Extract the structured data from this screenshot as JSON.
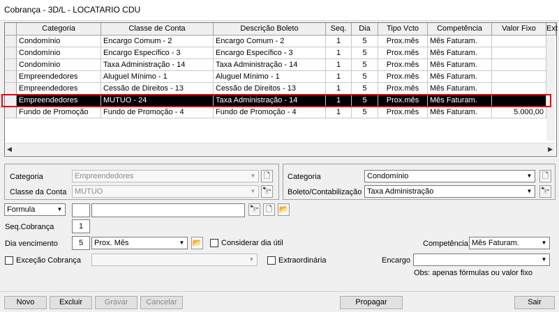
{
  "window": {
    "title": "Cobrança - 3D/L - LOCATARIO CDU"
  },
  "grid": {
    "columns": [
      "Categoria",
      "Classe de Conta",
      "Descrição Boleto",
      "Seq.",
      "Dia",
      "Tipo Vcto",
      "Competência",
      "Valor Fixo",
      "Ext"
    ],
    "rows": [
      [
        "Condomínio",
        "Encargo Comum - 2",
        "Encargo Comum - 2",
        "1",
        "5",
        "Prox.mês",
        "Mês Faturam.",
        ""
      ],
      [
        "Condomínio",
        "Encargo Específico - 3",
        "Encargo Específico - 3",
        "1",
        "5",
        "Prox.mês",
        "Mês Faturam.",
        ""
      ],
      [
        "Condomínio",
        "Taxa Administração - 14",
        "Taxa Administração - 14",
        "1",
        "5",
        "Prox.mês",
        "Mês Faturam.",
        ""
      ],
      [
        "Empreendedores",
        "Aluguel Mínimo - 1",
        "Aluguel Mínimo - 1",
        "1",
        "5",
        "Prox.mês",
        "Mês Faturam.",
        ""
      ],
      [
        "Empreendedores",
        "Cessão de Direitos - 13",
        "Cessão de Direitos - 13",
        "1",
        "5",
        "Prox.mês",
        "Mês Faturam.",
        ""
      ],
      [
        "Empreendedores",
        "MUTUO - 24",
        "Taxa Administração - 14",
        "1",
        "5",
        "Prox.mês",
        "Mês Faturam.",
        ""
      ],
      [
        "Fundo de Promoção",
        "Fundo de Promoção - 4",
        "Fundo de Promoção - 4",
        "1",
        "5",
        "Prox.mês",
        "Mês Faturam.",
        "5.000,00"
      ]
    ],
    "selected_row": 5
  },
  "left_panel": {
    "categoria_label": "Categoria",
    "categoria_value": "Empreendedores",
    "classe_label": "Classe da Conta",
    "classe_value": "MUTUO"
  },
  "right_panel": {
    "categoria_label": "Categoria",
    "categoria_value": "Condomínio",
    "boleto_label": "Boleto/Contabilização",
    "boleto_value": "Taxa Administração"
  },
  "form": {
    "formula_value": "Formula",
    "formula_code": "",
    "formula_text": "",
    "seq_label": "Seq.Cobrança",
    "seq_value": "1",
    "dia_label": "Dia vencimento",
    "dia_value": "5",
    "tipo_value": "Prox. Mês",
    "considerar_label": "Considerar dia útil",
    "competencia_label": "Competência",
    "competencia_value": "Mês Faturam.",
    "excecao_label": "Exceção Cobrança",
    "excecao_value": "",
    "extraordinaria_label": "Extraordinária",
    "encargo_label": "Encargo",
    "encargo_value": "",
    "obs": "Obs: apenas fórmulas ou valor fixo"
  },
  "buttons": {
    "novo": "Novo",
    "excluir": "Excluir",
    "gravar": "Gravar",
    "cancelar": "Cancelar",
    "propagar": "Propagar",
    "sair": "Sair"
  }
}
